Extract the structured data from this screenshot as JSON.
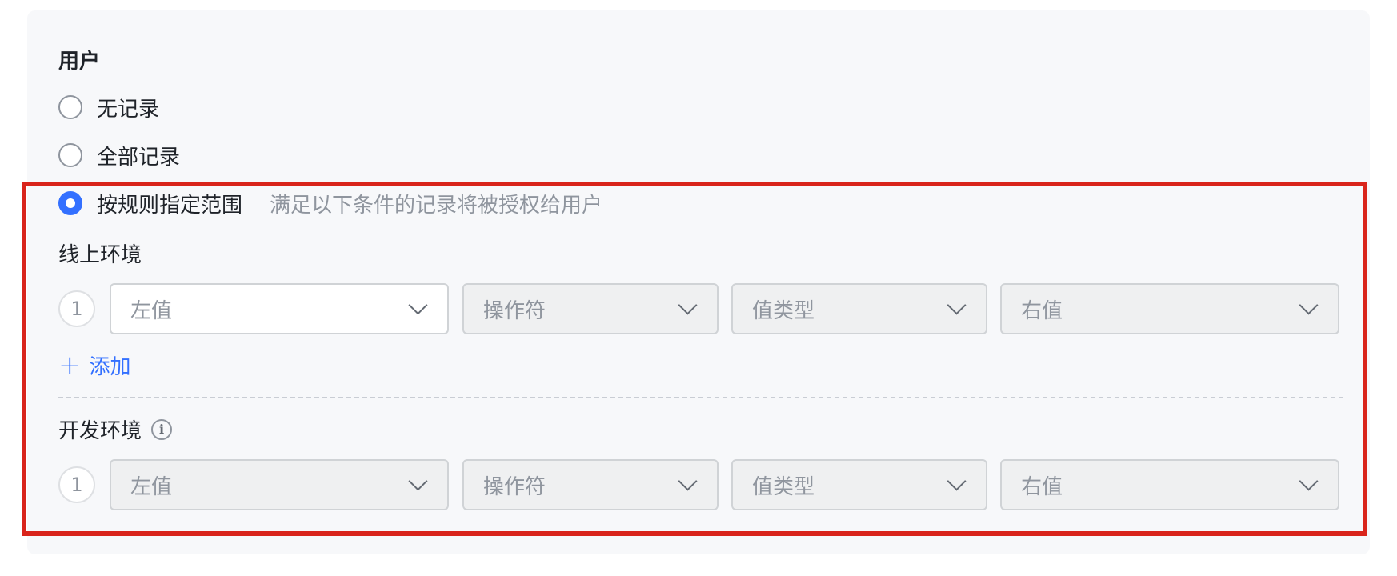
{
  "user_section": {
    "title": "用户",
    "options": [
      {
        "label": "无记录",
        "checked": false
      },
      {
        "label": "全部记录",
        "checked": false
      },
      {
        "label": "按规则指定范围",
        "checked": true,
        "hint": "满足以下条件的记录将被授权给用户"
      }
    ]
  },
  "online_env": {
    "title": "线上环境",
    "rule": {
      "index": "1",
      "left_value": "左值",
      "operator": "操作符",
      "value_type": "值类型",
      "right_value": "右值"
    },
    "add_label": "添加"
  },
  "dev_env": {
    "title": "开发环境",
    "info_icon": "info-icon",
    "rule": {
      "index": "1",
      "left_value": "左值",
      "operator": "操作符",
      "value_type": "值类型",
      "right_value": "右值"
    }
  },
  "colors": {
    "accent": "#3370ff",
    "highlight_border": "#d9241b",
    "panel_bg": "#f7f8fa"
  }
}
